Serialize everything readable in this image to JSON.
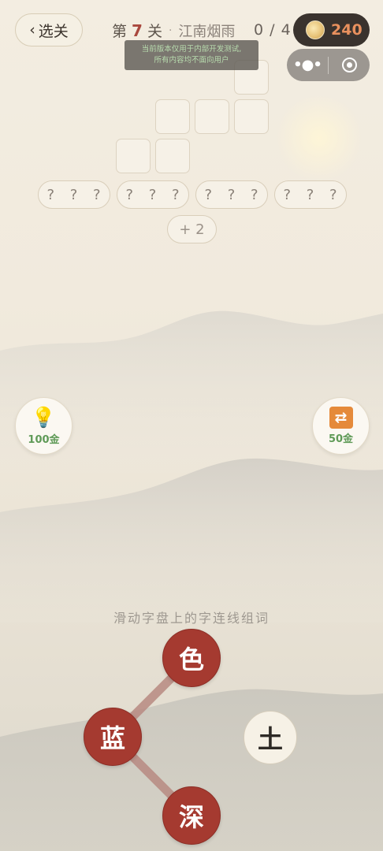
{
  "header": {
    "back_label": "选关",
    "level_prefix": "第",
    "level_number": "7",
    "level_suffix": "关",
    "separator": "·",
    "level_name": "江南烟雨",
    "progress": "0 / 4",
    "coins": "240"
  },
  "tip": {
    "line1": "当前版本仅用于内部开发测试,",
    "line2": "所有内容均不面向用户"
  },
  "answers": {
    "placeholders": [
      "? ? ?",
      "? ? ?",
      "? ? ?",
      "? ? ?"
    ],
    "extra": "+ 2"
  },
  "tools": {
    "hint_icon": "lightbulb-icon",
    "hint_cost": "100金",
    "shuffle_icon": "shuffle-icon",
    "shuffle_cost": "50金"
  },
  "wheel": {
    "instruction": "滑动字盘上的字连线组词",
    "letters": [
      "色",
      "蓝",
      "土",
      "深"
    ],
    "selected_color": "#a53a30",
    "idle_color": "#f6f1e6"
  }
}
